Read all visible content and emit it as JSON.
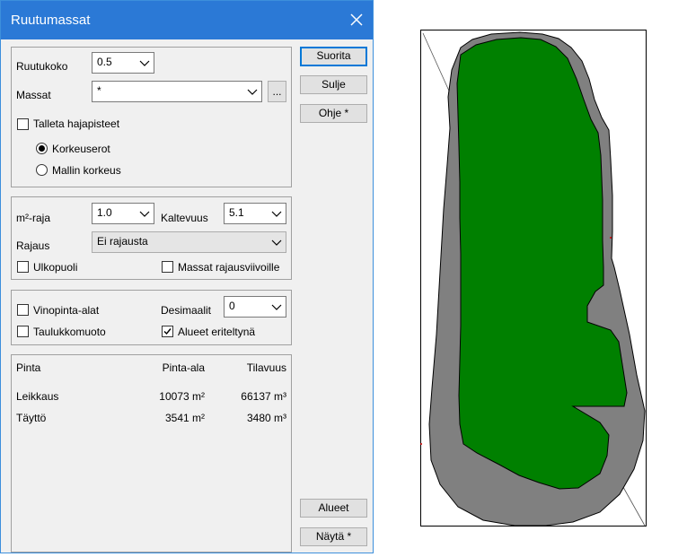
{
  "dialog": {
    "title": "Ruutumassat",
    "close_icon": "close-icon",
    "colors": {
      "titlebar": "#2b79d6",
      "button_focus": "#0078d7",
      "fill_green": "#008000",
      "fill_grey": "#808080"
    }
  },
  "settings": {
    "ruutukoko_label": "Ruutukoko",
    "ruutukoko_value": "0.5",
    "massat_label": "Massat",
    "massat_value": "*",
    "massat_browse_label": "...",
    "talleta_label": "Talleta hajapisteet",
    "talleta_checked": false,
    "radio_korkeuserot": "Korkeuserot",
    "radio_mallin": "Mallin korkeus",
    "radio_selected": "Korkeuserot"
  },
  "limits": {
    "m2raja_label": "m²-raja",
    "m2raja_value": "1.0",
    "kaltevuus_label": "Kaltevuus",
    "kaltevuus_value": "5.1",
    "rajaus_label": "Rajaus",
    "rajaus_value": "Ei rajausta",
    "ulkopuoli_label": "Ulkopuoli",
    "massat_rajaus_label": "Massat rajausviivoille"
  },
  "output": {
    "vinopinta_label": "Vinopinta-alat",
    "desimaalit_label": "Desimaalit",
    "desimaalit_value": "0",
    "taulukko_label": "Taulukkomuoto",
    "alueet_eriteltyna_label": "Alueet eriteltynä",
    "alueet_eriteltyna_checked": true
  },
  "results": {
    "headers": [
      "Pinta",
      "Pinta-ala",
      "Tilavuus"
    ],
    "rows": [
      {
        "name": "Leikkaus",
        "area": "10073 m²",
        "volume": "66137 m³"
      },
      {
        "name": "Täyttö",
        "area": "3541 m²",
        "volume": "3480 m³"
      }
    ]
  },
  "buttons": {
    "suorita": "Suorita",
    "sulje": "Sulje",
    "ohje": "Ohje *",
    "alueet": "Alueet",
    "nayta": "Näytä *"
  }
}
